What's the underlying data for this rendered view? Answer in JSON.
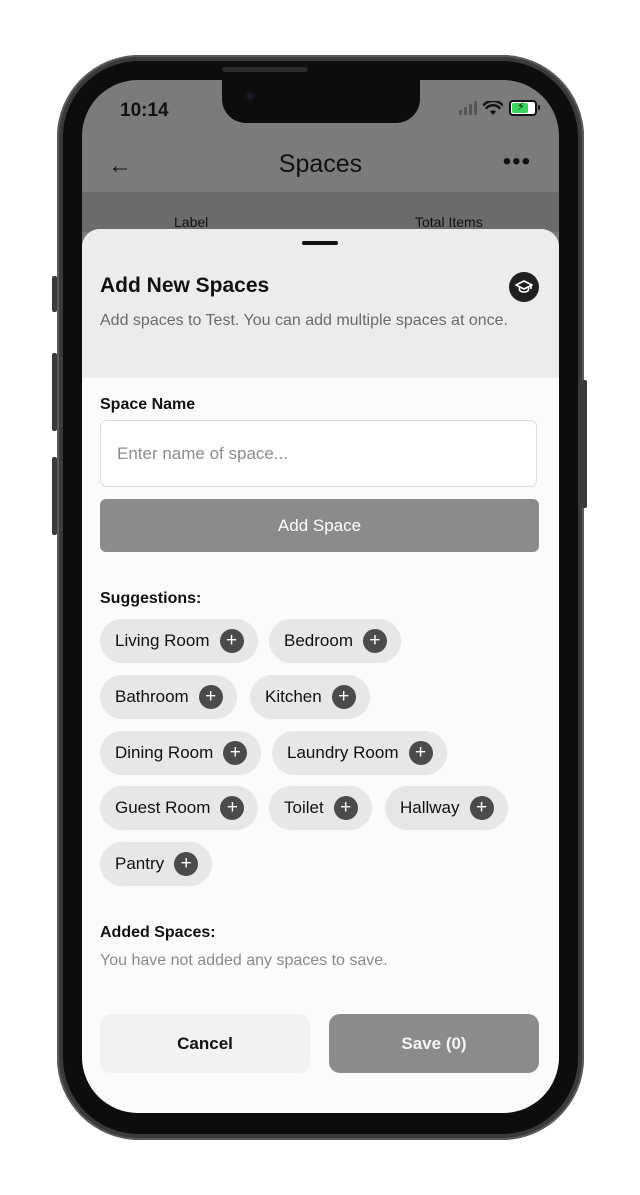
{
  "status_bar": {
    "time": "10:14",
    "icons": [
      "signal-icon",
      "wifi-icon",
      "battery-charging-icon"
    ]
  },
  "nav": {
    "back_icon": "←",
    "title": "Spaces",
    "more_icon": "•••"
  },
  "table_header": {
    "label": "Label",
    "total_items": "Total Items"
  },
  "sheet": {
    "title": "Add New Spaces",
    "subtitle": "Add spaces to Test. You can add multiple spaces at once.",
    "info_icon": "🎓",
    "space_name_label": "Space Name",
    "space_name_value": "",
    "space_name_placeholder": "Enter name of space...",
    "add_space_button": "Add Space",
    "suggestions_title": "Suggestions:",
    "suggestions": [
      "Living Room",
      "Bedroom",
      "Bathroom",
      "Kitchen",
      "Dining Room",
      "Laundry Room",
      "Guest Room",
      "Toilet",
      "Hallway",
      "Pantry"
    ],
    "plus_symbol": "+",
    "added_spaces_title": "Added Spaces:",
    "added_spaces_empty": "You have not added any spaces to save.",
    "cancel_button": "Cancel",
    "save_button": "Save (0)"
  },
  "colors": {
    "accent_gray": "#8b8b8b",
    "chip_bg": "#e7e7e7",
    "chip_plus_bg": "#4b4b4b"
  }
}
